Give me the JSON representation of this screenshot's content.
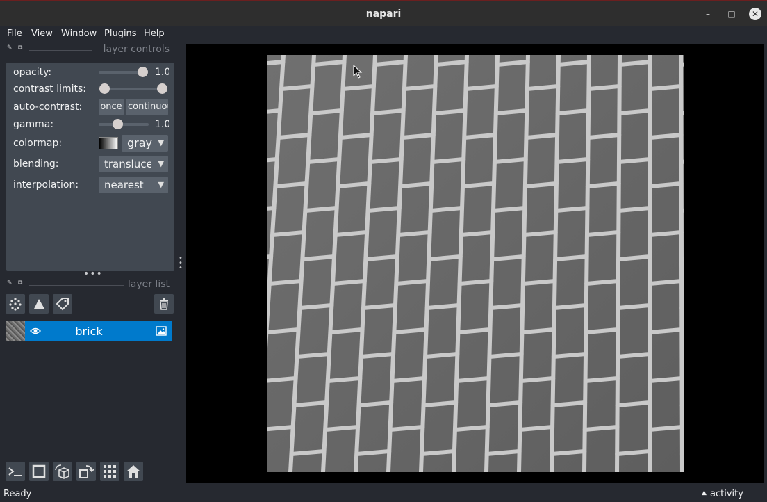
{
  "window": {
    "title": "napari",
    "minimize_glyph": "–",
    "maximize_glyph": "□",
    "close_glyph": "✕"
  },
  "menu": {
    "items": [
      "File",
      "View",
      "Window",
      "Plugins",
      "Help"
    ]
  },
  "layer_controls": {
    "header": "layer controls",
    "opacity": {
      "label": "opacity:",
      "value_text": "1.0",
      "level": 1.0
    },
    "contrast_limits": {
      "label": "contrast limits:",
      "low": 0.0,
      "high": 1.0
    },
    "auto_contrast": {
      "label": "auto-contrast:",
      "once_label": "once",
      "continuous_label": "continuous"
    },
    "gamma": {
      "label": "gamma:",
      "value_text": "1.0",
      "level": 0.36
    },
    "colormap": {
      "label": "colormap:",
      "selected": "gray"
    },
    "blending": {
      "label": "blending:",
      "selected": "translucent"
    },
    "interpolation": {
      "label": "interpolation:",
      "selected": "nearest"
    }
  },
  "layer_list": {
    "header": "layer list",
    "layers": [
      {
        "name": "brick",
        "visible": true,
        "type_icon": "image-icon"
      }
    ]
  },
  "viewer_buttons": [
    "console-icon",
    "2d-3d-toggle-icon",
    "roll-axes-icon",
    "transpose-icon",
    "grid-icon",
    "home-icon"
  ],
  "status": {
    "text": "Ready",
    "activity_label": "activity"
  },
  "colors": {
    "background": "#262930",
    "panel": "#414851",
    "accent": "#007acc"
  }
}
